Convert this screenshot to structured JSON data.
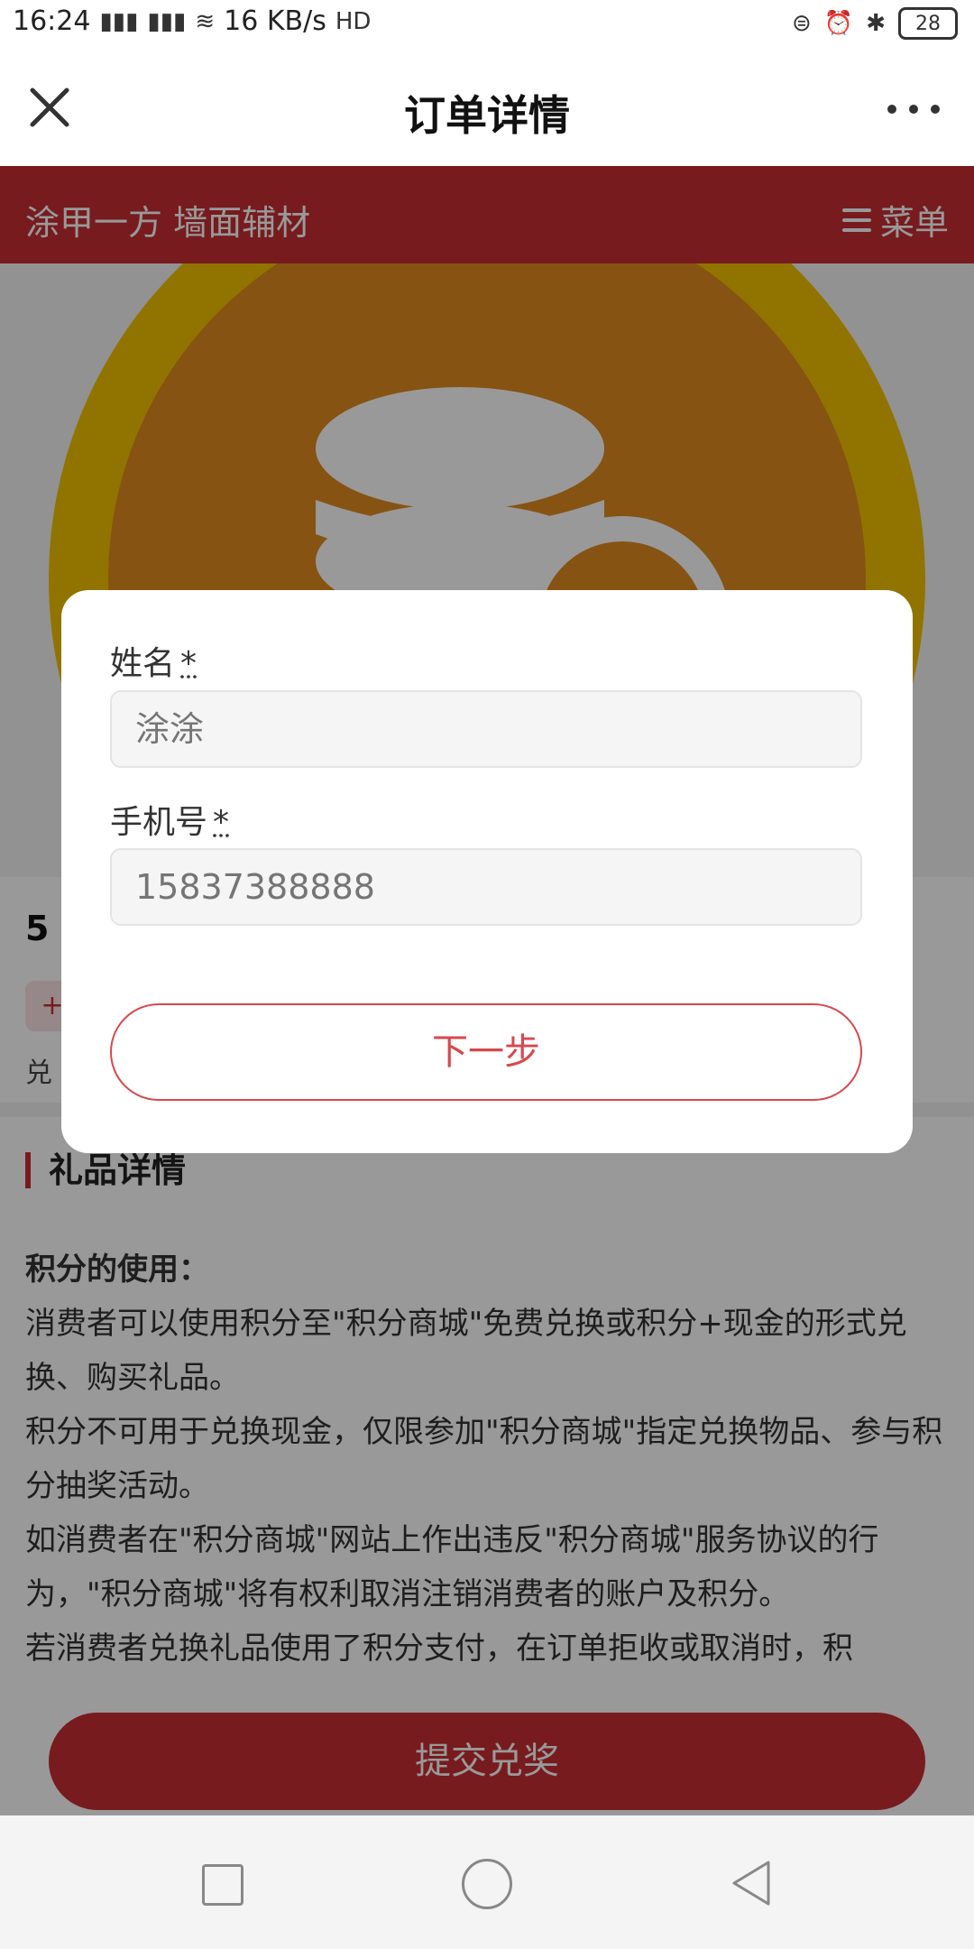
{
  "status_bar": {
    "time": "16:24",
    "net_speed": "16 KB/s",
    "battery": "28",
    "icons": [
      "4g-signal-icon",
      "4g-signal-icon",
      "wifi-icon",
      "hd-icon",
      "lock-icon",
      "alarm-icon",
      "bluetooth-icon",
      "battery-icon"
    ]
  },
  "nav": {
    "title": "订单详情",
    "left_icon": "close-icon",
    "right_icon": "more-icon"
  },
  "shop": {
    "name": "涂甲一方 墙面辅材",
    "menu_label": "菜单",
    "menu_icon": "hamburger-icon"
  },
  "product": {
    "title_visible": "5",
    "tag": "+",
    "note": "兑"
  },
  "details": {
    "section_title": "礼品详情",
    "heading": "积分的使用：",
    "lines": [
      "消费者可以使用积分至\"积分商城\"免费兑换或积分+现金的形式兑换、购买礼品。",
      "积分不可用于兑换现金，仅限参加\"积分商城\"指定兑换物品、参与积分抽奖活动。",
      "如消费者在\"积分商城\"网站上作出违反\"积分商城\"服务协议的行为，\"积分商城\"将有权利取消注销消费者的账户及积分。",
      "若消费者兑换礼品使用了积分支付，在订单拒收或取消时，积"
    ]
  },
  "submit_label": "提交兑奖",
  "modal": {
    "name_label": "姓名",
    "name_required": "*",
    "name_placeholder": "涂涂",
    "phone_label": "手机号",
    "phone_required": "*",
    "phone_placeholder": "15837388888",
    "next_label": "下一步"
  },
  "colors": {
    "brand_red": "#c62d33",
    "outline_red": "#d8484c",
    "coin_yellow": "#f2c200",
    "coin_orange": "#e08a1e"
  },
  "android_nav": [
    "recent-apps-icon",
    "home-icon",
    "back-icon"
  ]
}
